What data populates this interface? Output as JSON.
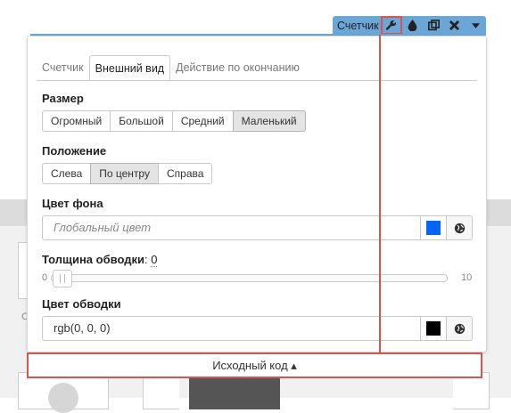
{
  "toolbar": {
    "label": "Счетчик",
    "buttons": [
      {
        "icon": "wrench-icon",
        "glyph": "🔧"
      },
      {
        "icon": "drop-icon",
        "glyph": "💧"
      },
      {
        "icon": "copy-icon",
        "glyph": "⧉"
      },
      {
        "icon": "close-icon",
        "glyph": "✖"
      },
      {
        "icon": "caret-down-icon",
        "glyph": "▾"
      }
    ],
    "accent": "#6aa6d6"
  },
  "tabs": [
    {
      "label": "Счетчик",
      "active": false
    },
    {
      "label": "Внешний вид",
      "active": true
    },
    {
      "label": "Действие по окончанию",
      "active": false
    }
  ],
  "size": {
    "title": "Размер",
    "options": [
      "Огромный",
      "Большой",
      "Средний",
      "Маленький"
    ],
    "selected": "Маленький"
  },
  "position": {
    "title": "Положение",
    "options": [
      "Слева",
      "По центру",
      "Справа"
    ],
    "selected": "По центру"
  },
  "background_color": {
    "title": "Цвет фона",
    "placeholder": "Глобальный цвет",
    "swatch": "#0066ff"
  },
  "border_width": {
    "title": "Толщина обводки",
    "value": "0",
    "min": "0",
    "max": "10"
  },
  "border_color": {
    "title": "Цвет обводки",
    "value": "rgb(0, 0, 0)",
    "swatch": "#000000"
  },
  "source_bar": {
    "label": "Исходный код ▴"
  },
  "highlight_color": "#d9534f"
}
